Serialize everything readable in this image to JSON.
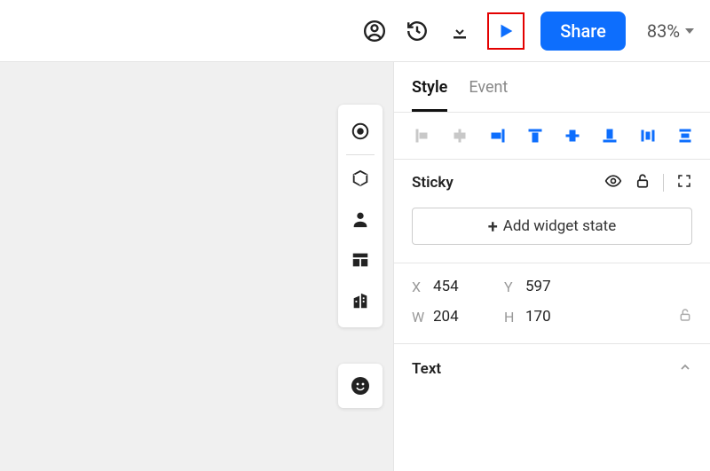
{
  "topbar": {
    "share_label": "Share",
    "zoom_label": "83%"
  },
  "panel": {
    "tabs": {
      "style": "Style",
      "event": "Event"
    },
    "sticky": {
      "title": "Sticky",
      "add_state_label": "Add widget state"
    },
    "geom": {
      "x_label": "X",
      "x_value": "454",
      "y_label": "Y",
      "y_value": "597",
      "w_label": "W",
      "w_value": "204",
      "h_label": "H",
      "h_value": "170"
    },
    "text": {
      "title": "Text"
    }
  }
}
